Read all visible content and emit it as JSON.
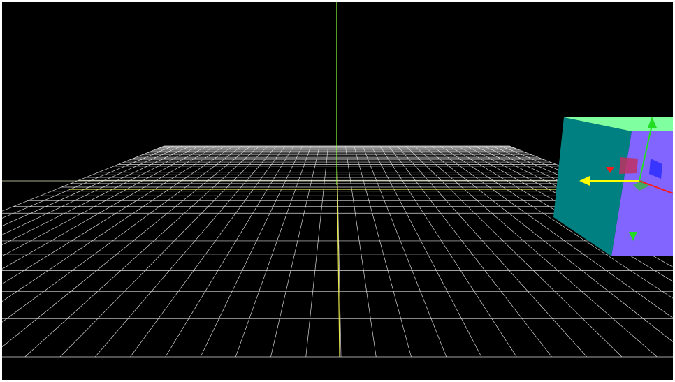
{
  "scene": {
    "background_color": "#000000",
    "grid": {
      "visible": true,
      "line_color": "#d8d8d8",
      "center_line_color": "#e8e84a",
      "divisions": 40
    },
    "axis_lines": {
      "vertical_axis_color": "#8cff3a",
      "horizon_line_color": "#e6e6b8"
    },
    "selected_object": {
      "type": "cube",
      "face_colors": {
        "left": "#008080",
        "front": "#8264ff",
        "top": "#80ffa0"
      }
    },
    "transform_gizmo": {
      "mode": "translate",
      "x_axis_color": "#ff1a1a",
      "y_axis_color": "#22dd22",
      "z_axis_color": "#ffff00",
      "xy_plane_color": "#c03060",
      "yz_plane_color": "#3030ff",
      "xz_plane_color": "#30c030"
    }
  }
}
